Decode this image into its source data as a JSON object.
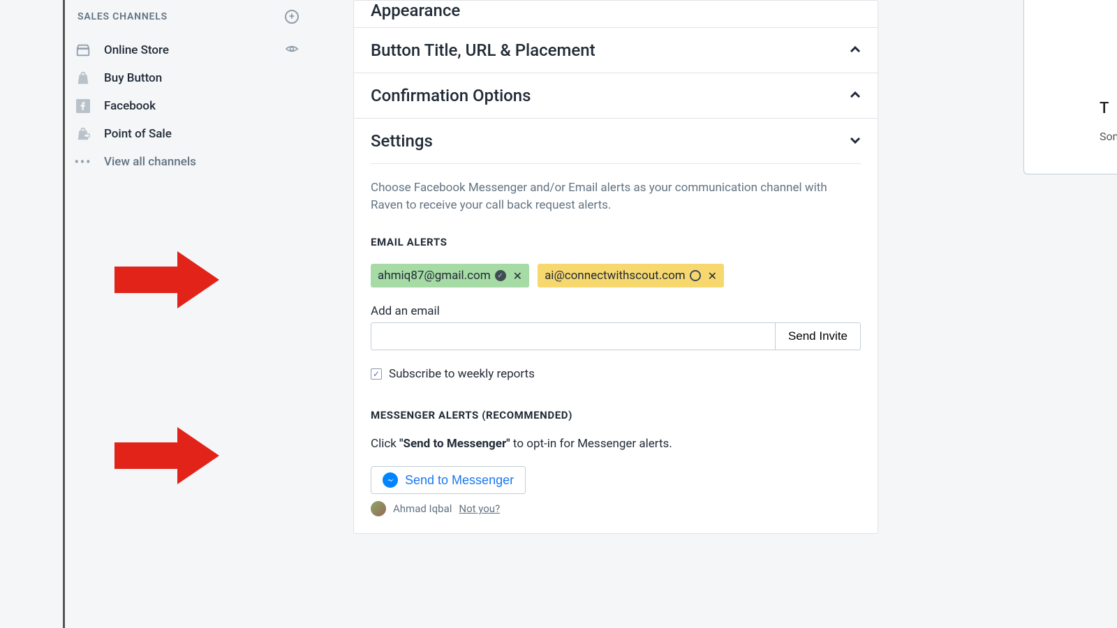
{
  "sidebar": {
    "header": "SALES CHANNELS",
    "items": [
      {
        "label": "Online Store"
      },
      {
        "label": "Buy Button"
      },
      {
        "label": "Facebook"
      },
      {
        "label": "Point of Sale"
      },
      {
        "label": "View all channels"
      }
    ]
  },
  "sections": {
    "appearance": "Appearance",
    "button_title": "Button Title, URL & Placement",
    "confirmation": "Confirmation Options",
    "settings": "Settings"
  },
  "settings": {
    "description": "Choose Facebook Messenger and/or Email alerts as your communication channel with Raven to receive your call back request alerts.",
    "email_heading": "EMAIL ALERTS",
    "emails": [
      {
        "address": "ahmiq87@gmail.com",
        "status": "verified"
      },
      {
        "address": "ai@connectwithscout.com",
        "status": "pending"
      }
    ],
    "add_email_label": "Add an email",
    "send_invite": "Send Invite",
    "subscribe_label": "Subscribe to weekly reports",
    "subscribe_checked": true,
    "messenger_heading": "MESSENGER ALERTS (RECOMMENDED)",
    "messenger_instr_pre": "Click ",
    "messenger_instr_bold": "\"Send to Messenger\"",
    "messenger_instr_post": " to opt-in for Messenger alerts.",
    "messenger_button": "Send to Messenger",
    "user_name": "Ahmad Iqbal",
    "not_you": "Not you?"
  },
  "right_panel": {
    "line1": "T",
    "line2": "Som"
  }
}
